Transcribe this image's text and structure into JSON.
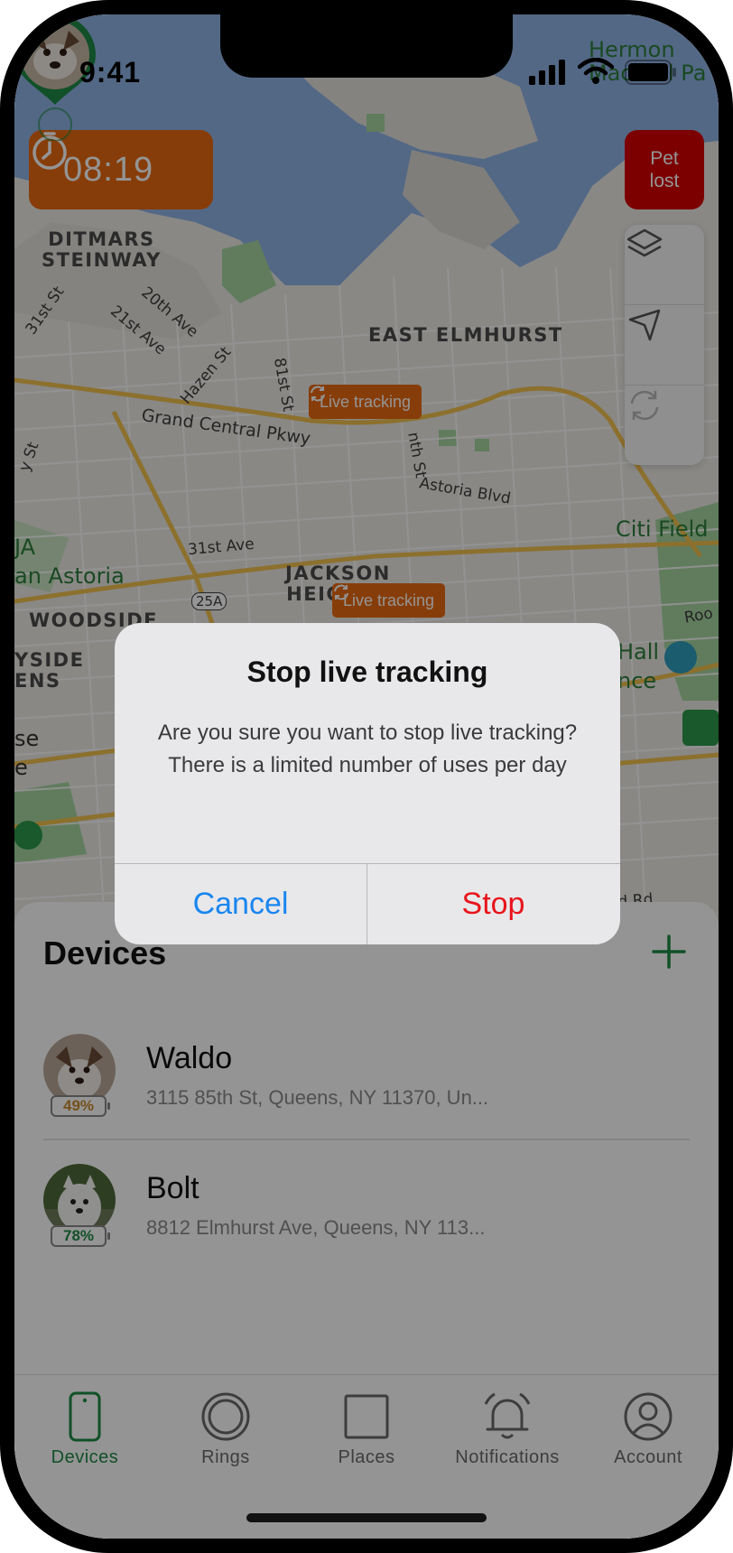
{
  "status_bar": {
    "time": "9:41"
  },
  "map": {
    "timer": "08:19",
    "pet_lost_label": "Pet\nlost",
    "neighborhoods": [
      "DITMARS\nSTEINWAY",
      "EAST ELMHURST",
      "JACKSON\nHEIGHTS",
      "WOODSIDE",
      "YSIDE\nENS"
    ],
    "streets": [
      "31st St",
      "21st Ave",
      "20th Ave",
      "Hazen St",
      "81st St",
      "Grand Central Pkwy",
      "31st Ave",
      "Astoria Blvd",
      "nth St",
      "25A",
      "Roo",
      "rd Rd",
      "y St"
    ],
    "green_places": [
      "Hermon\nMacNeil Pa",
      "Citi Field",
      "JA\nan Astoria",
      "Hall\nnce",
      "se\ne"
    ],
    "live_tracking_badge_1": "Live tracking",
    "live_tracking_badge_2": "Live tracking"
  },
  "devices": {
    "title": "Devices",
    "items": [
      {
        "name": "Waldo",
        "address": "3115 85th St, Queens, NY 11370, Un...",
        "battery": "49%"
      },
      {
        "name": "Bolt",
        "address": "8812 Elmhurst Ave, Queens, NY 113...",
        "battery": "78%"
      }
    ]
  },
  "tabs": [
    {
      "label": "Devices",
      "icon": "phone-icon",
      "active": true
    },
    {
      "label": "Rings",
      "icon": "ring-icon"
    },
    {
      "label": "Places",
      "icon": "square-icon"
    },
    {
      "label": "Notifications",
      "icon": "bell-icon"
    },
    {
      "label": "Account",
      "icon": "person-icon"
    }
  ],
  "alert": {
    "title": "Stop live tracking",
    "message": "Are you sure you want to stop live tracking? There is a limited number of uses per day",
    "cancel_label": "Cancel",
    "confirm_label": "Stop"
  },
  "colors": {
    "accent": "#1e8a45",
    "timer_bg": "#e86a10",
    "pet_lost_bg": "#d60000",
    "ios_blue": "#1a86ef",
    "destructive": "#e8141b",
    "water": "#8fb3e6"
  }
}
